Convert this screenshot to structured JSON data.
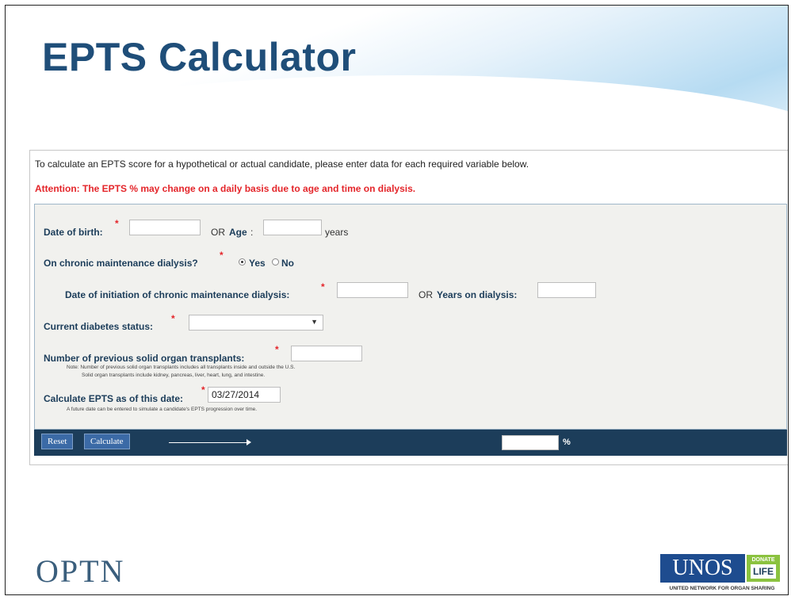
{
  "slide": {
    "title": "EPTS Calculator"
  },
  "intro_text": "To calculate an EPTS score for a hypothetical or actual candidate, please enter data for each required variable below.",
  "attention_text": "Attention: The EPTS % may change on a daily basis due to age and time on dialysis.",
  "form": {
    "dob_label": "Date of birth:",
    "or_label": "OR",
    "age_label": "Age",
    "years_label": "years",
    "dialysis_question": "On chronic maintenance dialysis?",
    "yes_label": "Yes",
    "no_label": "No",
    "dialysis_selected": "Yes",
    "dialysis_date_label": "Date of initiation of chronic maintenance dialysis:",
    "or2_label": "OR",
    "years_on_dialysis_label": "Years on dialysis:",
    "diabetes_label": "Current diabetes status:",
    "diabetes_value": "",
    "transplants_label": "Number of previous solid organ transplants:",
    "transplants_note_1": "Note: Number of previous solid organ transplants includes all transplants inside and outside the U.S.",
    "transplants_note_2": "Solid organ transplants include kidney, pancreas, liver, heart, lung, and intestine.",
    "calc_date_label": "Calculate EPTS as of this date:",
    "calc_date_value": "03/27/2014",
    "calc_date_note": "A future date can be entered to simulate a candidate's EPTS progression over time.",
    "required_mark": "*"
  },
  "actions": {
    "reset_label": "Reset",
    "calculate_label": "Calculate",
    "result_value": "",
    "percent_sign": "%"
  },
  "footer": {
    "left_logo_text": "OPTN",
    "unos_text": "UNOS",
    "donate_text": "DONATE",
    "life_text": "LIFE",
    "unos_tagline": "UNITED NETWORK FOR ORGAN SHARING"
  }
}
